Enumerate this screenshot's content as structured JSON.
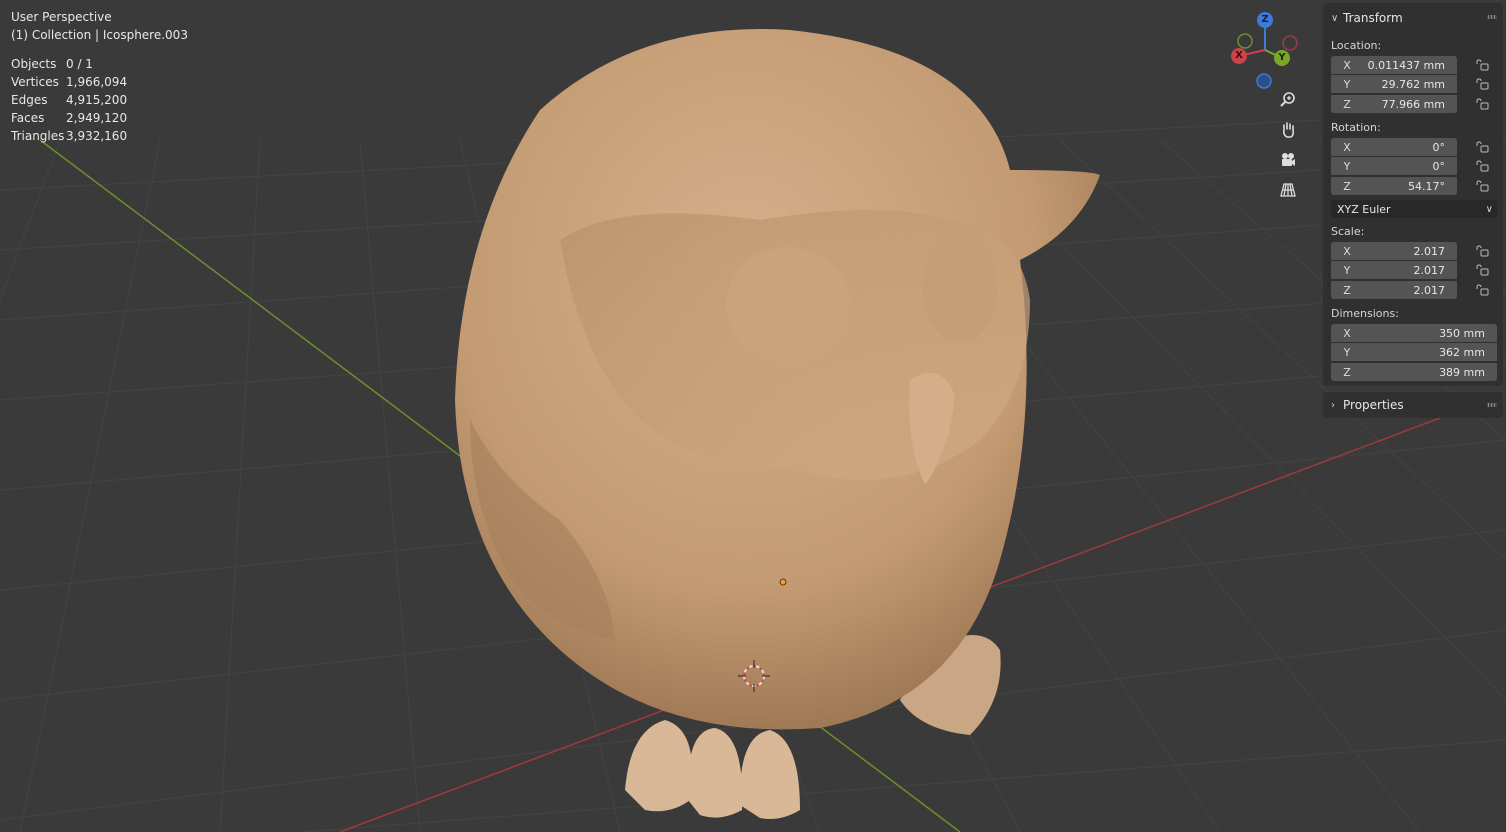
{
  "viewport": {
    "view_name": "User Perspective",
    "collection_line": "(1) Collection | Icosphere.003",
    "stats": [
      {
        "label": "Objects",
        "value": "0 / 1"
      },
      {
        "label": "Vertices",
        "value": "1,966,094"
      },
      {
        "label": "Edges",
        "value": "4,915,200"
      },
      {
        "label": "Faces",
        "value": "2,949,120"
      },
      {
        "label": "Triangles",
        "value": "3,932,160"
      }
    ],
    "gizmo": {
      "x": "X",
      "y": "Y",
      "z": "Z"
    },
    "nav_icons": [
      "zoom-icon",
      "pan-hand-icon",
      "camera-icon",
      "perspective-grid-icon"
    ],
    "colors": {
      "background": "#3a3a3a",
      "x_axis": "#9b3b3b",
      "y_axis": "#6f8f2a",
      "model": "#c9a27a"
    }
  },
  "transform": {
    "title": "Transform",
    "location_label": "Location:",
    "location": [
      {
        "axis": "X",
        "value": "0.011437 mm"
      },
      {
        "axis": "Y",
        "value": "29.762 mm"
      },
      {
        "axis": "Z",
        "value": "77.966 mm"
      }
    ],
    "rotation_label": "Rotation:",
    "rotation": [
      {
        "axis": "X",
        "value": "0°"
      },
      {
        "axis": "Y",
        "value": "0°"
      },
      {
        "axis": "Z",
        "value": "54.17°"
      }
    ],
    "rotation_mode": "XYZ Euler",
    "scale_label": "Scale:",
    "scale": [
      {
        "axis": "X",
        "value": "2.017"
      },
      {
        "axis": "Y",
        "value": "2.017"
      },
      {
        "axis": "Z",
        "value": "2.017"
      }
    ],
    "dimensions_label": "Dimensions:",
    "dimensions": [
      {
        "axis": "X",
        "value": "350 mm"
      },
      {
        "axis": "Y",
        "value": "362 mm"
      },
      {
        "axis": "Z",
        "value": "389 mm"
      }
    ]
  },
  "properties": {
    "title": "Properties"
  }
}
